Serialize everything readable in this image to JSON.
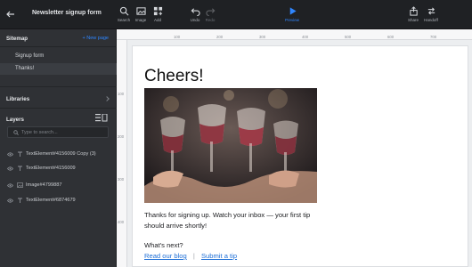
{
  "app": {
    "doc_title": "Newsletter signup form",
    "toolbar": {
      "search": "Search",
      "image": "Image",
      "add": "Add",
      "undo": "Undo",
      "redo": "Redo",
      "preview": "Preview",
      "share": "Share",
      "handoff": "Handoff"
    }
  },
  "sidebar": {
    "sitemap": {
      "title": "Sitemap",
      "new_page": "+ New page",
      "pages": [
        "Signup form",
        "Thanks!"
      ]
    },
    "libraries": {
      "title": "Libraries"
    },
    "layers": {
      "title": "Layers",
      "search_placeholder": "Type to search...",
      "items": [
        "TextElement#4156009 Copy (3)",
        "TextElement#4156009",
        "Image#4799887",
        "TextElement#6874679"
      ]
    }
  },
  "rulers": {
    "top": [
      "100",
      "200",
      "300",
      "400",
      "500",
      "600",
      "700"
    ],
    "left": [
      "100",
      "200",
      "300",
      "400"
    ]
  },
  "page": {
    "title": "Cheers!",
    "body": "Thanks for signing up. Watch your inbox — your first tip should arrive shortly!",
    "next": "What's next?",
    "links": [
      "Read our blog",
      "Submit a tip"
    ],
    "link_separator": "|"
  },
  "colors": {
    "accent": "#2f86ff",
    "link": "#1f6fd6",
    "sidebar": "#2f3135",
    "topbar": "#1f2124"
  }
}
